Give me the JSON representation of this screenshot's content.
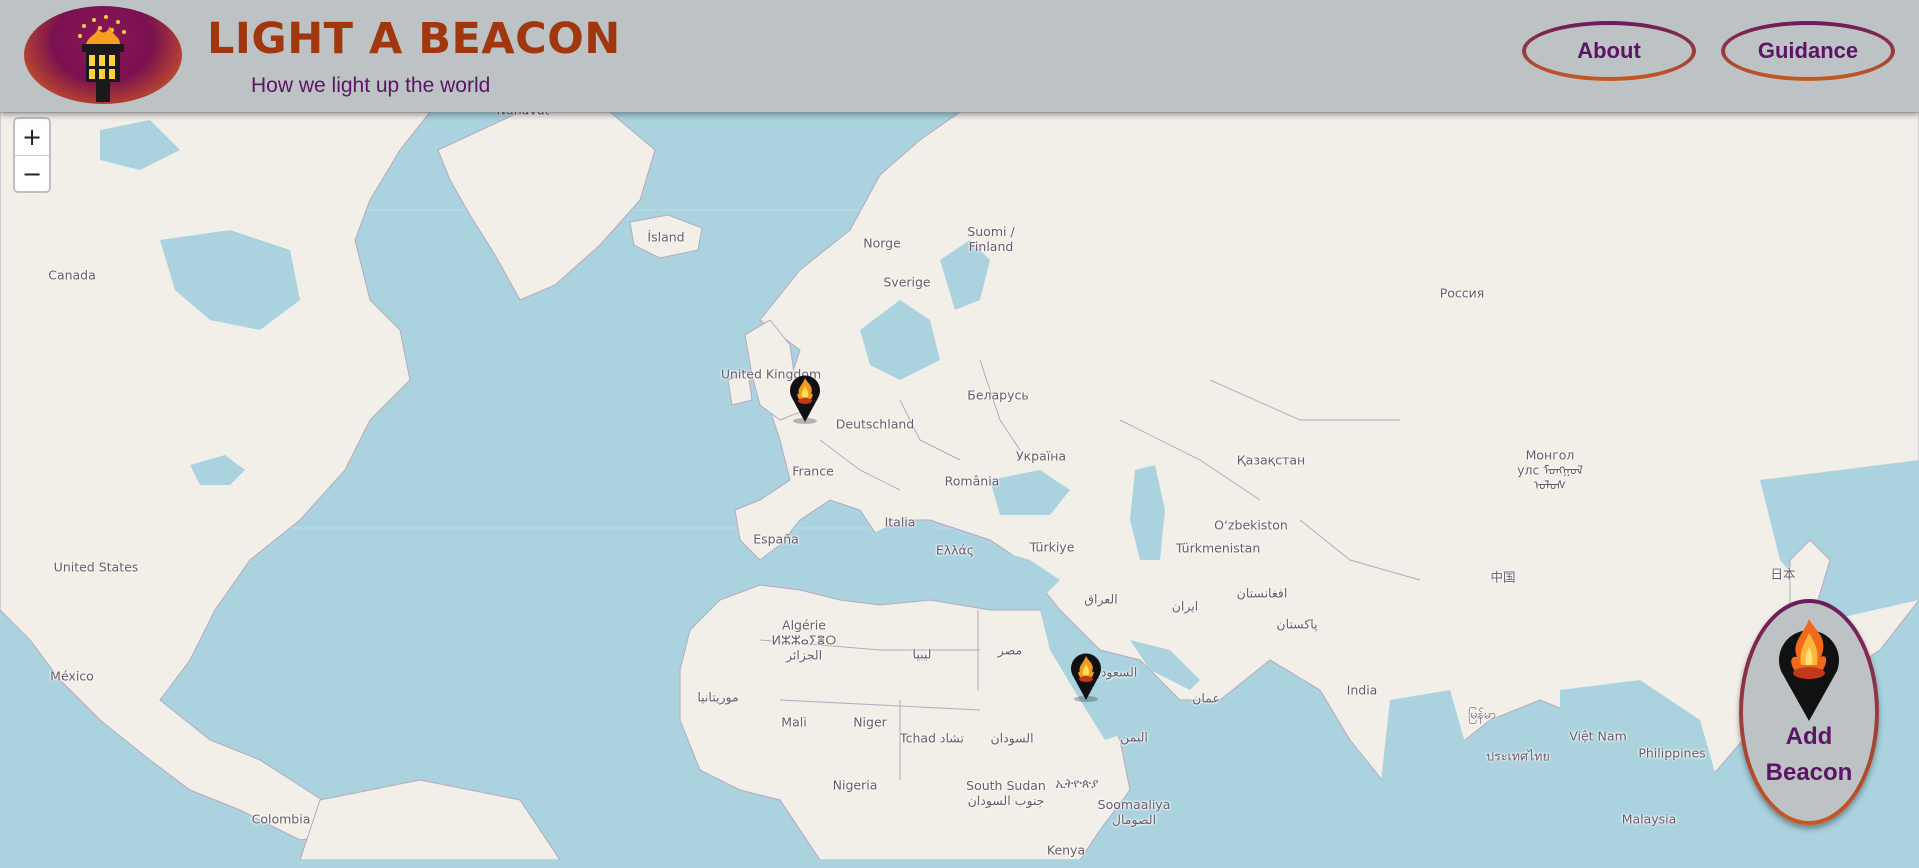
{
  "header": {
    "title": "LIGHT A BEACON",
    "subtitle": "How we light up the world",
    "nav": [
      {
        "label": "About"
      },
      {
        "label": "Guidance"
      }
    ],
    "logo_icon": "beacon-torch-icon"
  },
  "zoom": {
    "in_label": "+",
    "out_label": "−"
  },
  "map": {
    "labels": {
      "nunavut": "Nunavut",
      "island": "Ísland",
      "canada": "Canada",
      "norge": "Norge",
      "suomi": "Suomi /\nFinland",
      "sverige": "Sverige",
      "rossiya": "Россия",
      "uk": "United Kingdom",
      "belarus": "Беларусь",
      "deutschland": "Deutschland",
      "ukraina": "Україна",
      "france": "France",
      "romania": "România",
      "kazakhstan": "Қазақстан",
      "mongol": "Монгол\nулс ᠮᠣᠩᠭᠣᠯ\nᠤᠯᠤᠰ",
      "italia": "Italia",
      "espana": "España",
      "ellas": "Ελλάς",
      "turkiye": "Türkiye",
      "uzbekistan": "Oʻzbekiston",
      "turkmenistan": "Türkmenistan",
      "united_states": "United States",
      "iraq": "العراق",
      "iran": "ایران",
      "afghanistan": "افغانستان",
      "pakistan": "پاکستان",
      "china": "中国",
      "japan": "日本",
      "algerie": "Algérie\nⵍⵣⵣⴰⵢⴻⵔ\nالجزائر",
      "libya": "ليبيا",
      "misr": "مصر",
      "saudi": "السعودية",
      "mexico": "México",
      "mauritania": "موريتانيا",
      "oman": "عمان",
      "india": "India",
      "myanmar": "မြန်မာ",
      "mali": "Mali",
      "niger": "Niger",
      "tchad": "Tchad تشاد",
      "sudan": "السودان",
      "yemen": "اليمن",
      "vietnam": "Việt Nam",
      "thailand": "ประเทศไทย",
      "philippines": "Philippines",
      "nigeria": "Nigeria",
      "south_sudan": "South Sudan\nجنوب السودان",
      "ethiopia": "ኢትዮጵያ",
      "somalia": "Soomaaliya\nالصومال",
      "colombia": "Colombia",
      "malaysia": "Malaysia",
      "kenya": "Kenya"
    },
    "markers": [
      {
        "name": "beacon-marker-uk",
        "icon": "flame-marker-icon"
      },
      {
        "name": "beacon-marker-arabia",
        "icon": "flame-marker-icon"
      }
    ]
  },
  "add_beacon": {
    "line1": "Add",
    "line2": "Beacon",
    "icon": "flame-marker-icon"
  }
}
